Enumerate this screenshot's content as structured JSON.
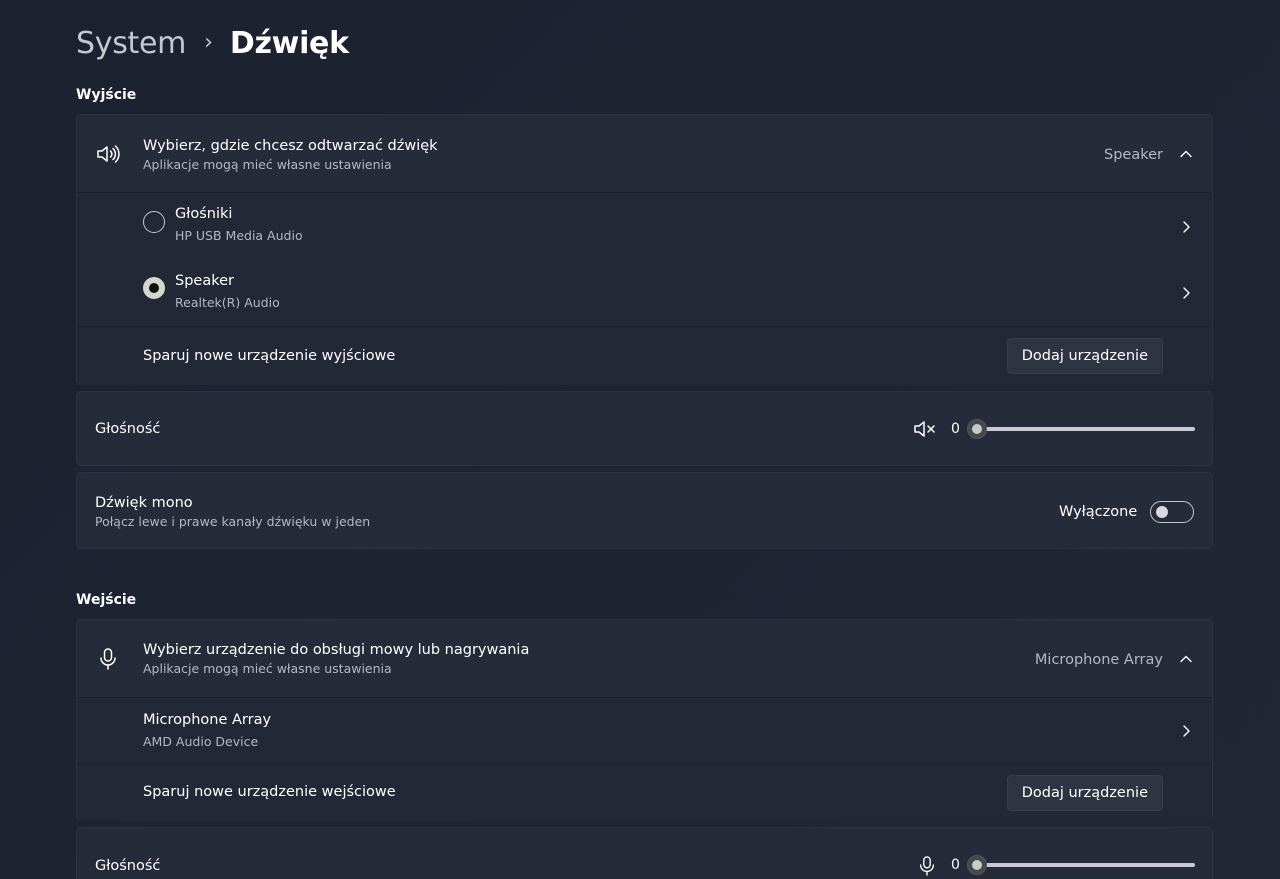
{
  "breadcrumb": {
    "parent": "System",
    "current": "Dźwięk"
  },
  "output": {
    "section_title": "Wyjście",
    "device_picker": {
      "title": "Wybierz, gdzie chcesz odtwarzać dźwięk",
      "subtitle": "Aplikacje mogą mieć własne ustawienia",
      "selected": "Speaker",
      "icon": "speaker-icon",
      "expanded": true
    },
    "devices": [
      {
        "name": "Głośniki",
        "detail": "HP USB Media Audio",
        "selected": false
      },
      {
        "name": "Speaker",
        "detail": "Realtek(R) Audio",
        "selected": true
      }
    ],
    "pair": {
      "label": "Sparuj nowe urządzenie wyjściowe",
      "button": "Dodaj urządzenie"
    },
    "volume": {
      "label": "Głośność",
      "value": "0",
      "level": 0,
      "icon": "speaker-muted-icon"
    },
    "mono": {
      "title": "Dźwięk mono",
      "subtitle": "Połącz lewe i prawe kanały dźwięku w jeden",
      "state_label": "Wyłączone",
      "on": false
    }
  },
  "input": {
    "section_title": "Wejście",
    "device_picker": {
      "title": "Wybierz urządzenie do obsługi mowy lub nagrywania",
      "subtitle": "Aplikacje mogą mieć własne ustawienia",
      "selected": "Microphone Array",
      "icon": "microphone-icon",
      "expanded": true
    },
    "devices": [
      {
        "name": "Microphone Array",
        "detail": "AMD Audio Device"
      }
    ],
    "pair": {
      "label": "Sparuj nowe urządzenie wejściowe",
      "button": "Dodaj urządzenie"
    },
    "volume": {
      "label": "Głośność",
      "value": "0",
      "level": 0,
      "icon": "microphone-icon"
    }
  }
}
